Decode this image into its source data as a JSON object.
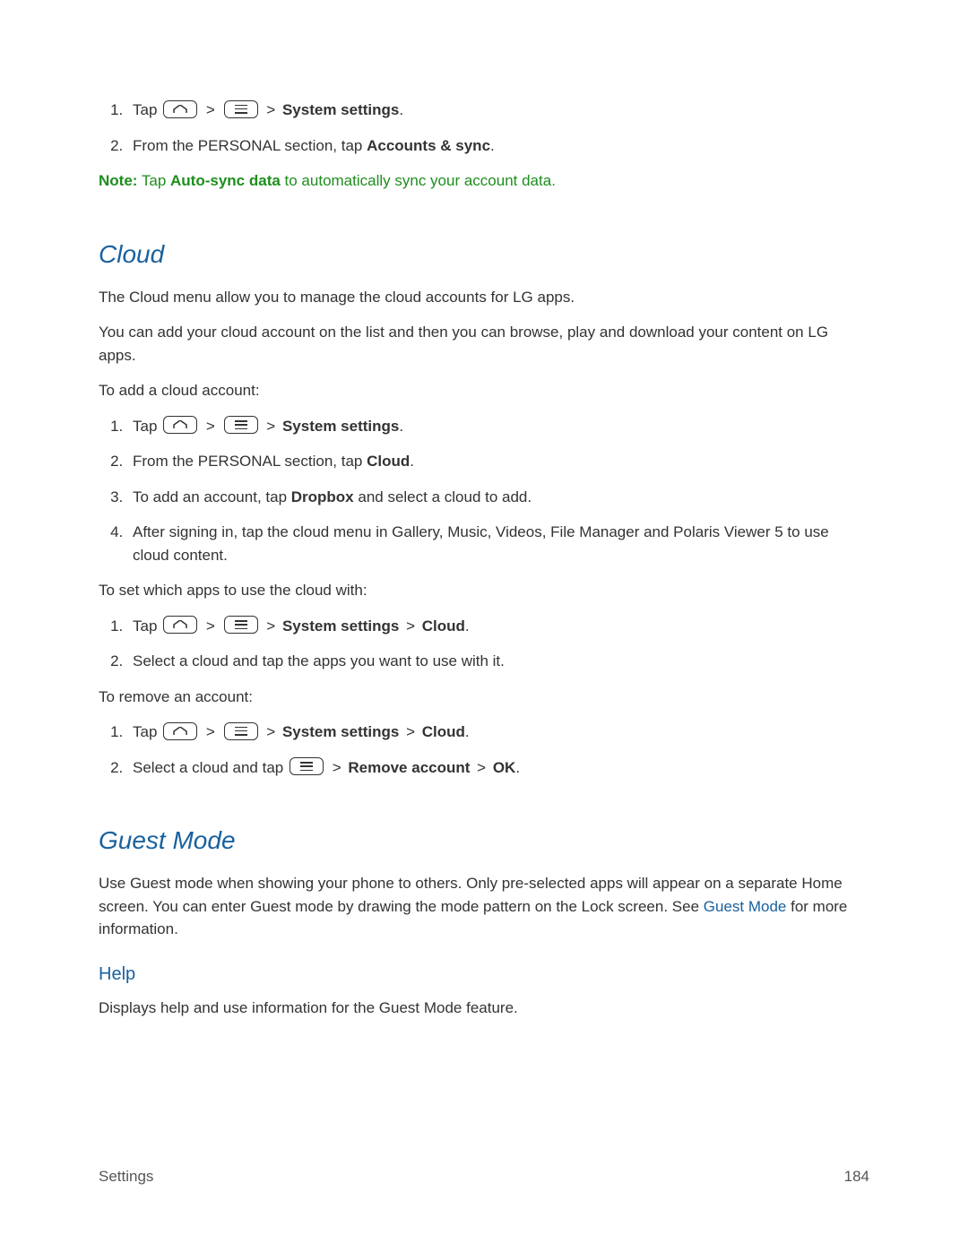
{
  "list1": {
    "item1": {
      "tap": "Tap",
      "gt": ">",
      "dest": "System settings",
      "dot": "."
    },
    "item2": {
      "a": "From the PERSONAL section, tap ",
      "b": "Accounts & sync",
      "dot": "."
    }
  },
  "note": {
    "label": "Note:",
    "a": " Tap ",
    "b": "Auto-sync data",
    "c": " to automatically sync your account data."
  },
  "cloud": {
    "heading": "Cloud",
    "p1": "The Cloud menu allow you to manage the cloud accounts for LG apps.",
    "p2": "You can add your cloud account on the list and then you can browse, play and download your content on LG apps.",
    "p3": "To add a cloud account:",
    "steps1": {
      "i1": {
        "tap": "Tap",
        "gt": ">",
        "dest": "System settings",
        "dot": "."
      },
      "i2": {
        "a": "From the PERSONAL section, tap ",
        "b": "Cloud",
        "dot": "."
      },
      "i3": {
        "a": "To add an account, tap ",
        "b": "Dropbox",
        "c": " and select a cloud to add."
      },
      "i4": "After signing in, tap the cloud menu in Gallery, Music, Videos, File Manager and Polaris Viewer 5 to use cloud content."
    },
    "p4": "To set which apps to use the cloud with:",
    "steps2": {
      "i1": {
        "tap": "Tap",
        "gt": ">",
        "d1": "System settings",
        "d2": "Cloud",
        "dot": "."
      },
      "i2": "Select a cloud and tap the apps you want to use with it."
    },
    "p5": "To remove an account:",
    "steps3": {
      "i1": {
        "tap": "Tap",
        "gt": ">",
        "d1": "System settings",
        "d2": "Cloud",
        "dot": "."
      },
      "i2": {
        "a": "Select a cloud and tap",
        "gt": ">",
        "b": "Remove account",
        "c": "OK",
        "dot": "."
      }
    }
  },
  "guest": {
    "heading": "Guest Mode",
    "p1a": "Use Guest mode when showing your phone to others. Only pre-selected apps will appear on a separate Home screen. You can enter Guest mode by drawing the mode pattern on the Lock screen. See ",
    "p1link": "Guest Mode",
    "p1b": " for more information.",
    "help": "Help",
    "help_p": "Displays help and use information for the Guest Mode feature."
  },
  "footer": {
    "left": "Settings",
    "right": "184"
  }
}
